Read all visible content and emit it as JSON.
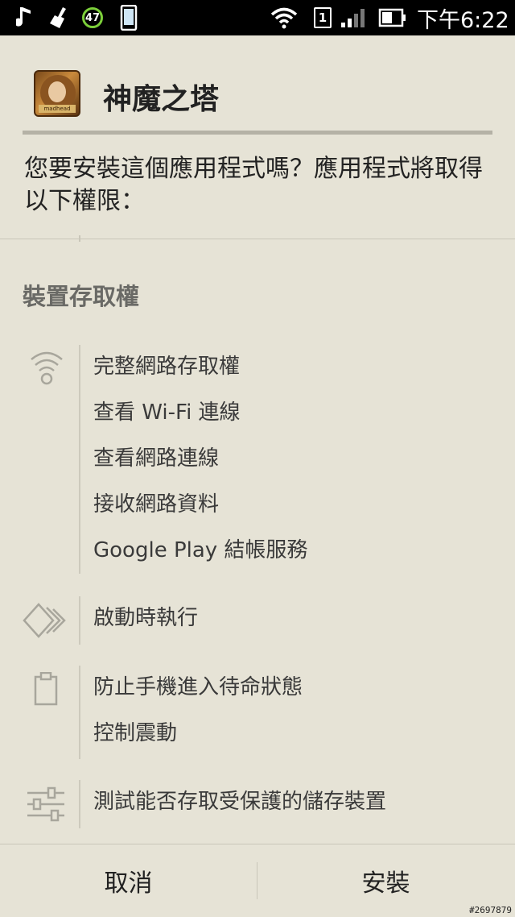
{
  "status_bar": {
    "battery_level": "47",
    "sim_slot": "1",
    "time": "下午6:22",
    "icons": [
      "music-icon",
      "cleaner-icon",
      "battery-saver-icon",
      "phone-icon",
      "wifi-icon",
      "sim-icon",
      "signal-icon",
      "battery-icon"
    ]
  },
  "dialog": {
    "app_name": "神魔之塔",
    "app_icon_text": "madhead",
    "question": "您要安裝這個應用程式嗎？應用程式將取得以下權限：",
    "section_title": "裝置存取權",
    "groups": [
      {
        "icon": "wifi-icon",
        "items": [
          "完整網路存取權",
          "查看 Wi-Fi 連線",
          "查看網路連線",
          "接收網路資料",
          "Google Play 結帳服務"
        ]
      },
      {
        "icon": "startup-arrows-icon",
        "items": [
          "啟動時執行"
        ]
      },
      {
        "icon": "clipboard-icon",
        "items": [
          "防止手機進入待命狀態",
          "控制震動"
        ]
      },
      {
        "icon": "sliders-icon",
        "items": [
          "測試能否存取受保護的儲存裝置"
        ]
      }
    ]
  },
  "buttons": {
    "cancel": "取消",
    "install": "安裝"
  },
  "watermark": "#2697879"
}
